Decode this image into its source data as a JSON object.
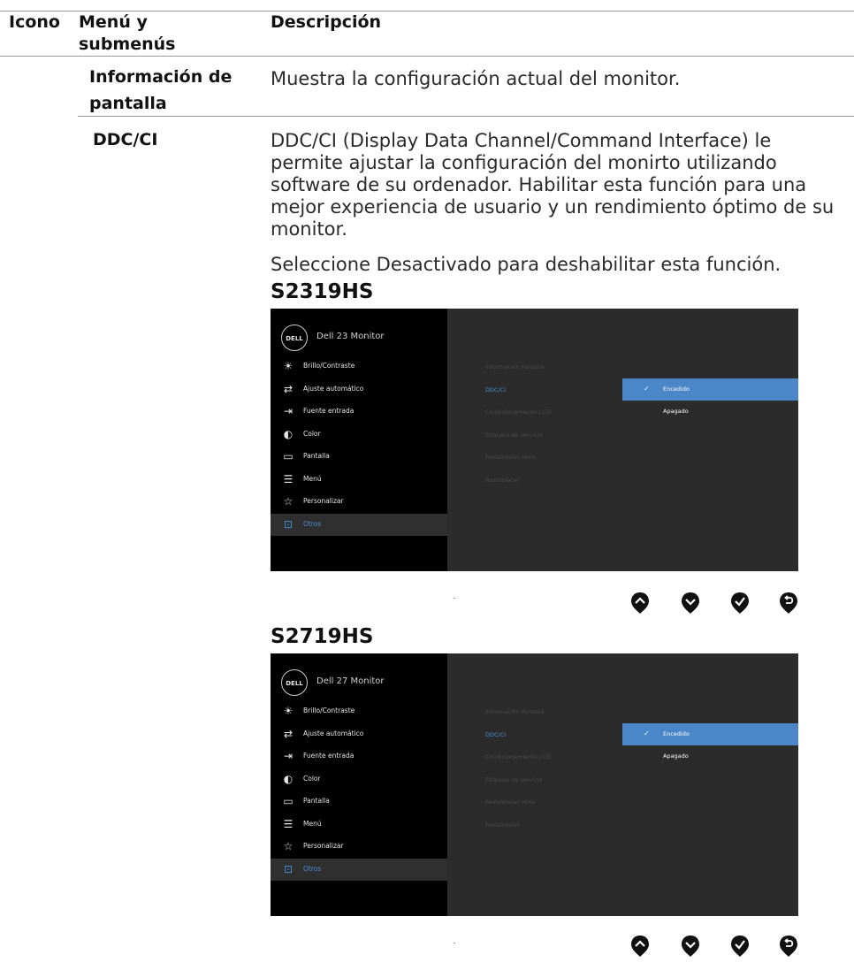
{
  "table": {
    "headers": {
      "icon": "Icono",
      "menu": "Menú y submenús",
      "description": "Descripción"
    },
    "rows": [
      {
        "menu": "Información de pantalla",
        "description": [
          "Muestra la configuración actual del monitor."
        ]
      },
      {
        "menu": "DDC/CI",
        "description": [
          "DDC/CI (Display Data Channel/Command Interface) le permite ajustar la configuración del monirto utilizando software de su ordenador. Habilitar esta función para una mejor experiencia de usuario y un rendimiento óptimo de su monitor.",
          "Seleccione Desactivado para deshabilitar esta función."
        ]
      }
    ]
  },
  "osd_items": [
    "Brillo/Contraste",
    "Ajuste automático",
    "Fuente entrada",
    "Color",
    "Pantalla",
    "Menú",
    "Personalizar",
    "Otros"
  ],
  "osd_icons": [
    "brightness-icon",
    "auto-adjust-icon",
    "input-source-icon",
    "color-icon",
    "display-icon",
    "menu-icon",
    "star-icon",
    "others-icon"
  ],
  "submenu": [
    "Información Pantalla",
    "DDC/CI",
    "Condicionamiento LCD",
    "Etiqueta de servicio",
    "Restablecer otros",
    "Restablecer"
  ],
  "options": [
    "Encedido",
    "Apagado"
  ],
  "logo_text": "DELL",
  "models": [
    {
      "name": "S2319HS",
      "monitor_title": "Dell 23 Monitor"
    },
    {
      "name": "S2719HS",
      "monitor_title": "Dell 27 Monitor"
    }
  ],
  "active_item": "Otros",
  "selected_submenu": "DDC/CI",
  "selected_option": "Encedido",
  "buttons": [
    "up-button-icon",
    "down-button-icon",
    "check-button-icon",
    "back-button-icon"
  ],
  "colors": {
    "accent": "#4a86c8",
    "osd_bg": "#2b2b2b",
    "osd_sidebar": "#000000"
  }
}
